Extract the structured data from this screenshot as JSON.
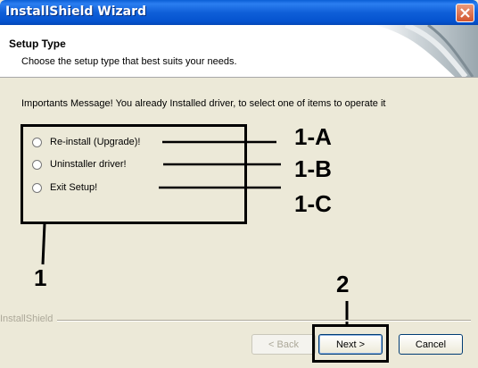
{
  "window": {
    "title": "InstallShield Wizard",
    "close_icon": "close-icon"
  },
  "header": {
    "title": "Setup Type",
    "subtitle": "Choose the setup type that best suits your needs."
  },
  "message": "Importants Message! You already Installed driver, to select one of items to operate it",
  "options": [
    {
      "label": "Re-install (Upgrade)!",
      "callout": "1-A"
    },
    {
      "label": "Uninstaller driver!",
      "callout": "1-B"
    },
    {
      "label": "Exit Setup!",
      "callout": "1-C"
    }
  ],
  "annotations": {
    "group": "1",
    "next": "2"
  },
  "footer": {
    "brand": "InstallShield"
  },
  "buttons": {
    "back": "< Back",
    "next": "Next >",
    "cancel": "Cancel"
  },
  "colors": {
    "titlebar": "#0553cf",
    "dialog_bg": "#ece9d8",
    "close": "#d2552f"
  }
}
